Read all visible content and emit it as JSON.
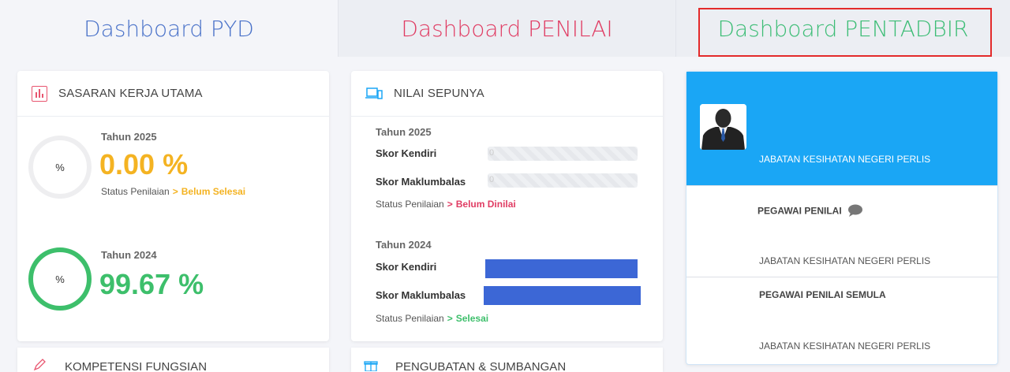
{
  "tabs": {
    "pyd": "Dashboard PYD",
    "penilai": "Dashboard PENILAI",
    "pentadbir": "Dashboard PENTADBIR"
  },
  "skt": {
    "title": "SASARAN KERJA UTAMA",
    "icon": "bar-chart-icon",
    "entries": [
      {
        "circle": "%",
        "year": "Tahun 2025",
        "percent": "0.00 %",
        "status_label": "Status Penilaian",
        "arrow": ">",
        "status_value": "Belum Selesai",
        "progress": 0.0
      },
      {
        "circle": "%",
        "year": "Tahun 2024",
        "percent": "99.67 %",
        "status_label": "Status Penilaian",
        "arrow": ">",
        "status_value": "Selesai",
        "progress": 99.67
      }
    ]
  },
  "nilai": {
    "title": "NILAI SEPUNYA",
    "icon": "laptop-icon",
    "y2025": {
      "year": "Tahun 2025",
      "kendiri_label": "Skor Kendiri",
      "kendiri_value": "0",
      "makl_label": "Skor Maklumbalas",
      "makl_value": "0",
      "status_label": "Status Penilaian",
      "arrow": ">",
      "status_value": "Belum Dinilai"
    },
    "y2024": {
      "year": "Tahun 2024",
      "kendiri_label": "Skor Kendiri",
      "makl_label": "Skor Maklumbalas",
      "status_label": "Status Penilaian",
      "arrow": ">",
      "status_value": "Selesai"
    }
  },
  "profile": {
    "org": "JABATAN KESIHATAN NEGERI PERLIS",
    "penilai_title": "PEGAWAI PENILAI",
    "penilai_org": "JABATAN KESIHATAN NEGERI PERLIS",
    "semula_title": "PEGAWAI PENILAI SEMULA",
    "semula_org": "JABATAN KESIHATAN NEGERI PERLIS"
  },
  "peek": {
    "kompetensi": "KOMPETENSI FUNGSIAN",
    "pengubatan": "PENGUBATAN & SUMBANGAN"
  },
  "colors": {
    "accent_blue": "#1aa6f5",
    "pyd": "#4a72c9",
    "penilai": "#e03c63",
    "pentadbir": "#3dbd76",
    "bar": "#3c67d6",
    "highlight": "#e32a2a"
  }
}
